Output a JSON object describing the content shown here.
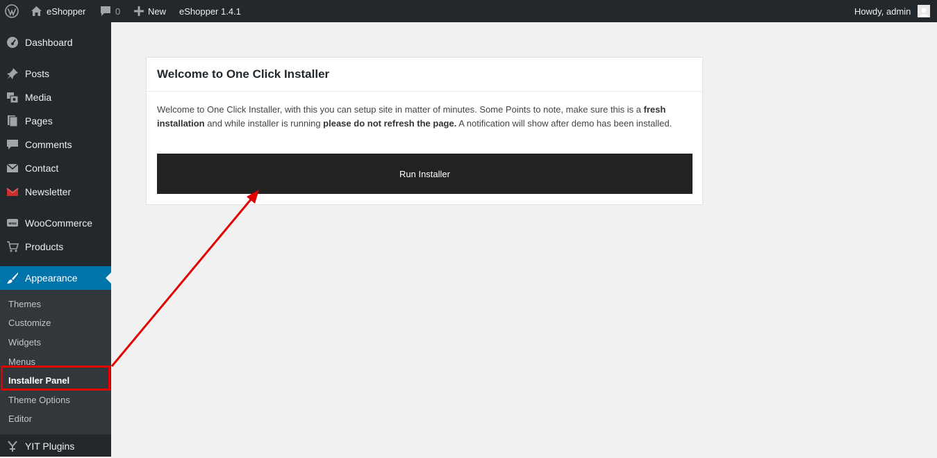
{
  "admin_bar": {
    "site_name": "eShopper",
    "comments_count": "0",
    "new_label": "New",
    "theme_version": "eShopper 1.4.1",
    "greeting": "Howdy, admin"
  },
  "sidebar": {
    "items": [
      {
        "label": "Dashboard",
        "icon": "dashboard-icon"
      },
      {
        "label": "Posts",
        "icon": "pin-icon"
      },
      {
        "label": "Media",
        "icon": "media-icon"
      },
      {
        "label": "Pages",
        "icon": "pages-icon"
      },
      {
        "label": "Comments",
        "icon": "comment-icon"
      },
      {
        "label": "Contact",
        "icon": "envelope-icon"
      },
      {
        "label": "Newsletter",
        "icon": "newsletter-icon"
      },
      {
        "label": "WooCommerce",
        "icon": "woo-icon"
      },
      {
        "label": "Products",
        "icon": "cart-icon"
      },
      {
        "label": "Appearance",
        "icon": "brush-icon"
      },
      {
        "label": "YIT Plugins",
        "icon": "yit-icon"
      }
    ],
    "appearance_submenu": [
      {
        "label": "Themes"
      },
      {
        "label": "Customize"
      },
      {
        "label": "Widgets"
      },
      {
        "label": "Menus"
      },
      {
        "label": "Installer Panel"
      },
      {
        "label": "Theme Options"
      },
      {
        "label": "Editor"
      }
    ]
  },
  "main": {
    "card_title": "Welcome to One Click Installer",
    "description": {
      "part1": "Welcome to One Click Installer, with this you can setup site in matter of minutes. Some Points to note, make sure this is a ",
      "bold1": "fresh installation",
      "part2": " and while installer is running ",
      "bold2": "please do not refresh the page.",
      "part3": " A notification will show after demo has been installed."
    },
    "run_button_label": "Run Installer"
  },
  "colors": {
    "admin_bar_bg": "#23282d",
    "sidebar_bg": "#23282d",
    "submenu_bg": "#32373c",
    "active_bg": "#0073aa",
    "button_bg": "#222222",
    "annotation_red": "#e00000"
  }
}
